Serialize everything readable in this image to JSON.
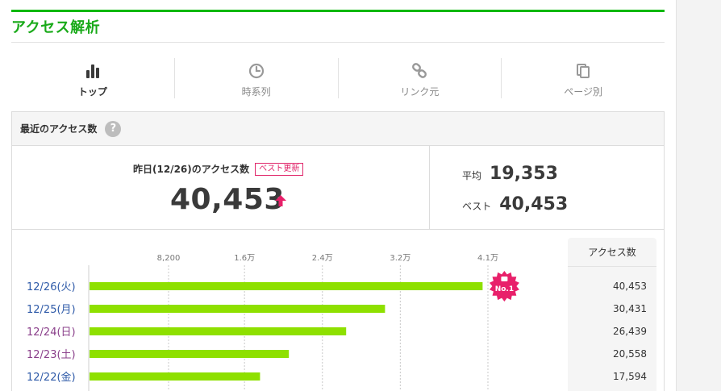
{
  "header": {
    "title": "アクセス解析"
  },
  "tabs": [
    {
      "label": "トップ",
      "icon": "bar-chart-icon",
      "active": true
    },
    {
      "label": "時系列",
      "icon": "clock-icon",
      "active": false
    },
    {
      "label": "リンク元",
      "icon": "link-icon",
      "active": false
    },
    {
      "label": "ページ別",
      "icon": "pages-icon",
      "active": false
    }
  ],
  "panel": {
    "title": "最近のアクセス数",
    "help": "?"
  },
  "summary": {
    "yesterday_label": "昨日(12/26)のアクセス数",
    "badge": "ベスト更新",
    "yesterday_count": "40,453",
    "average_label": "平均",
    "average_value": "19,353",
    "best_label": "ベスト",
    "best_value": "40,453"
  },
  "colors": {
    "accent_green": "#08b808",
    "bar_green": "#8ee000",
    "badge_pink": "#e0266a",
    "weekday_blue": "#2e5aa8",
    "weekend_purple": "#8a3f8a"
  },
  "chart_data": {
    "type": "bar",
    "orientation": "horizontal",
    "categories": [
      "12/26(火)",
      "12/25(月)",
      "12/24(日)",
      "12/23(土)",
      "12/22(金)"
    ],
    "values": [
      40453,
      30431,
      26439,
      20558,
      17594
    ],
    "tick_values": [
      8200,
      16000,
      24000,
      32000,
      41000
    ],
    "tick_labels": [
      "8,200",
      "1.6万",
      "2.4万",
      "3.2万",
      "4.1万"
    ],
    "xlim": [
      0,
      41000
    ],
    "grid": true,
    "highlight_label": "No.1"
  },
  "table": {
    "header": "アクセス数",
    "values": [
      "40,453",
      "30,431",
      "26,439",
      "20,558",
      "17,594"
    ]
  }
}
